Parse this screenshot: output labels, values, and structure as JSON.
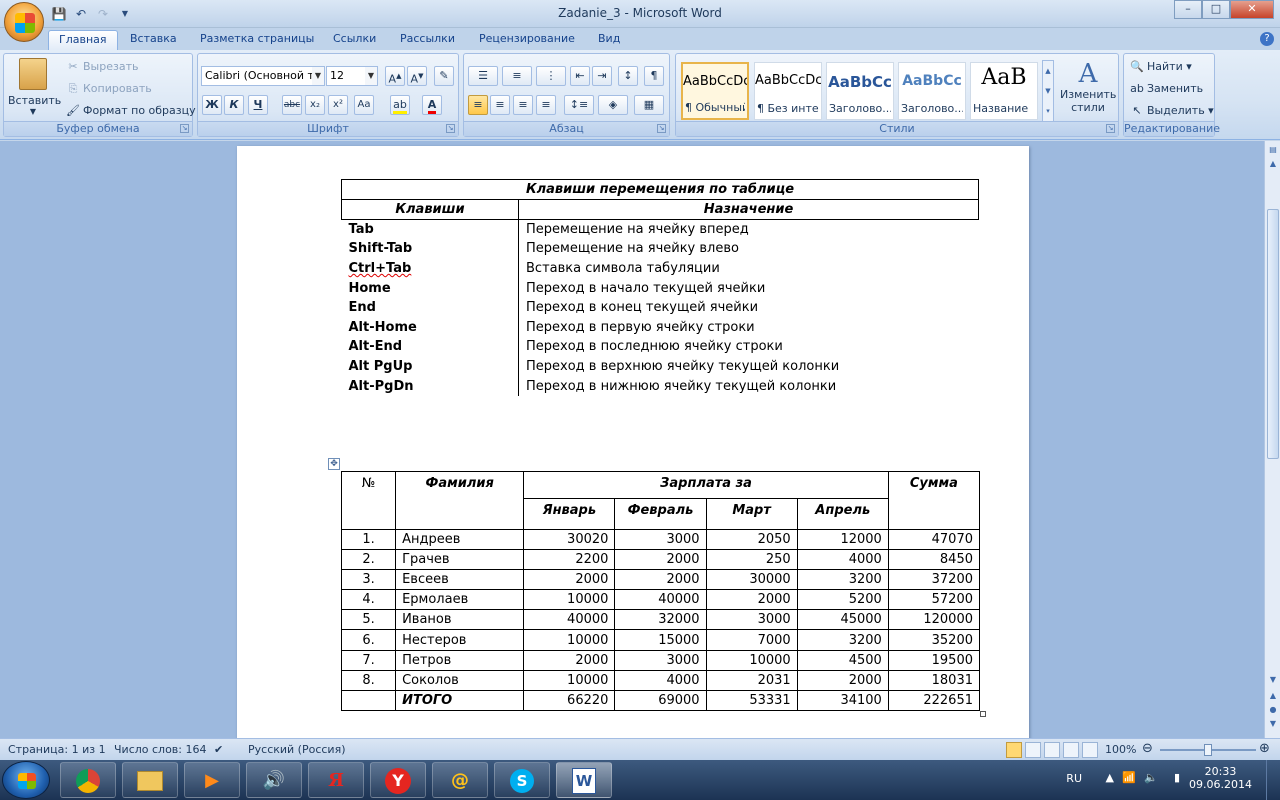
{
  "window": {
    "title": "Zadanie_3 - Microsoft Word",
    "controls": {
      "minimize": "–",
      "maximize": "□",
      "close": "✕"
    }
  },
  "quick_access": {
    "icons": [
      "save-icon",
      "undo-icon",
      "redo-icon",
      "customize-icon"
    ]
  },
  "tabs": [
    "Главная",
    "Вставка",
    "Разметка страницы",
    "Ссылки",
    "Рассылки",
    "Рецензирование",
    "Вид"
  ],
  "ribbon": {
    "clipboard": {
      "label": "Буфер обмена",
      "paste": "Вставить",
      "cut": "Вырезать",
      "copy": "Копировать",
      "format_painter": "Формат по образцу"
    },
    "font": {
      "label": "Шрифт",
      "font_name": "Calibri (Основной те",
      "font_size": "12",
      "bold": "Ж",
      "italic": "К",
      "underline": "Ч",
      "strike": "abc",
      "subscript": "x₂",
      "superscript": "x²",
      "change_case": "Aa"
    },
    "paragraph": {
      "label": "Абзац"
    },
    "styles": {
      "label": "Стили",
      "items": [
        {
          "sample": "AaBbCcDc",
          "name": "¶ Обычный"
        },
        {
          "sample": "AaBbCcDc",
          "name": "¶ Без инте..."
        },
        {
          "sample": "AaBbCc",
          "name": "Заголово..."
        },
        {
          "sample": "AaBbCc",
          "name": "Заголово..."
        },
        {
          "sample": "AaB",
          "name": "Название"
        }
      ],
      "change_styles": "Изменить стили"
    },
    "editing": {
      "label": "Редактирование",
      "find": "Найти",
      "replace": "Заменить",
      "select": "Выделить"
    }
  },
  "keys_table": {
    "title": "Клавиши перемещения по таблице",
    "col_keys": "Клавиши",
    "col_purpose": "Назначение",
    "rows": [
      {
        "key": "Tab",
        "purpose": "Перемещение на ячейку вперед"
      },
      {
        "key": "Shift-Tab",
        "purpose": "Перемещение на ячейку влево"
      },
      {
        "key": "Ctrl+Tab",
        "purpose": "Вставка символа табуляции"
      },
      {
        "key": "Home",
        "purpose": "Переход в начало текущей ячейки"
      },
      {
        "key": "End",
        "purpose": "Переход в конец текущей ячейки"
      },
      {
        "key": "Alt-Home",
        "purpose": "Переход в первую ячейку строки"
      },
      {
        "key": "Alt-End",
        "purpose": "Переход в последнюю ячейку строки"
      },
      {
        "key": "Alt PgUp",
        "purpose": "Переход в верхнюю ячейку текущей колонки"
      },
      {
        "key": "Alt-PgDn",
        "purpose": "Переход в нижнюю ячейку текущей колонки"
      }
    ]
  },
  "salary_table": {
    "col_no": "№",
    "col_surname": "Фамилия",
    "col_salary_for": "Зарплата за",
    "col_sum": "Сумма",
    "months": [
      "Январь",
      "Февраль",
      "Март",
      "Апрель"
    ],
    "rows": [
      {
        "n": "1.",
        "name": "Андреев",
        "jan": "30020",
        "feb": "3000",
        "mar": "2050",
        "apr": "12000",
        "sum": "47070"
      },
      {
        "n": "2.",
        "name": "Грачев",
        "jan": "2200",
        "feb": "2000",
        "mar": "250",
        "apr": "4000",
        "sum": "8450"
      },
      {
        "n": "3.",
        "name": "Евсеев",
        "jan": "2000",
        "feb": "2000",
        "mar": "30000",
        "apr": "3200",
        "sum": "37200"
      },
      {
        "n": "4.",
        "name": "Ермолаев",
        "jan": "10000",
        "feb": "40000",
        "mar": "2000",
        "apr": "5200",
        "sum": "57200"
      },
      {
        "n": "5.",
        "name": "Иванов",
        "jan": "40000",
        "feb": "32000",
        "mar": "3000",
        "apr": "45000",
        "sum": "120000"
      },
      {
        "n": "6.",
        "name": "Нестеров",
        "jan": "10000",
        "feb": "15000",
        "mar": "7000",
        "apr": "3200",
        "sum": "35200"
      },
      {
        "n": "7.",
        "name": "Петров",
        "jan": "2000",
        "feb": "3000",
        "mar": "10000",
        "apr": "4500",
        "sum": "19500"
      },
      {
        "n": "8.",
        "name": "Соколов",
        "jan": "10000",
        "feb": "4000",
        "mar": "2031",
        "apr": "2000",
        "sum": "18031"
      }
    ],
    "total": {
      "label": "ИТОГО",
      "jan": "66220",
      "feb": "69000",
      "mar": "53331",
      "apr": "34100",
      "sum": "222651"
    }
  },
  "status": {
    "page": "Страница: 1 из 1",
    "words": "Число слов: 164",
    "language": "Русский (Россия)",
    "zoom": "100%"
  },
  "taskbar": {
    "apps": [
      "chrome-icon",
      "explorer-icon",
      "media-player-icon",
      "speaker-app-icon",
      "yandex-icon",
      "yandex-browser-icon",
      "mail-icon",
      "skype-icon",
      "word-icon"
    ],
    "lang": "RU",
    "time": "20:33",
    "date": "09.06.2014"
  },
  "colors": {
    "ribbon_bg": "#d5e3f3",
    "workspace_bg": "#9db9de",
    "taskbar_bg": "#1c3353"
  }
}
